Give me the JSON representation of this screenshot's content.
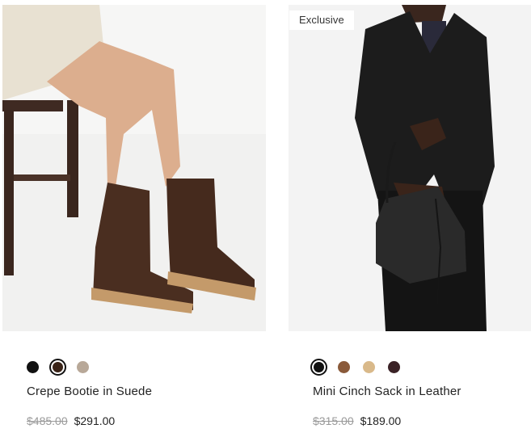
{
  "products": [
    {
      "name": "Crepe Bootie in Suede",
      "original_price": "$485.00",
      "sale_price": "$291.00",
      "badge": "",
      "swatches": [
        {
          "name": "Black",
          "color": "#111111",
          "selected": false
        },
        {
          "name": "Brown",
          "color": "#3a2418",
          "selected": true
        },
        {
          "name": "Taupe",
          "color": "#b8a898",
          "selected": false
        }
      ]
    },
    {
      "name": "Mini Cinch Sack in Leather",
      "original_price": "$315.00",
      "sale_price": "$189.00",
      "badge": "Exclusive",
      "swatches": [
        {
          "name": "Black",
          "color": "#111111",
          "selected": true
        },
        {
          "name": "Cognac",
          "color": "#8a5a3a",
          "selected": false
        },
        {
          "name": "Camel",
          "color": "#d9b98a",
          "selected": false
        },
        {
          "name": "Dark Brown",
          "color": "#3a2226",
          "selected": false
        }
      ]
    }
  ]
}
